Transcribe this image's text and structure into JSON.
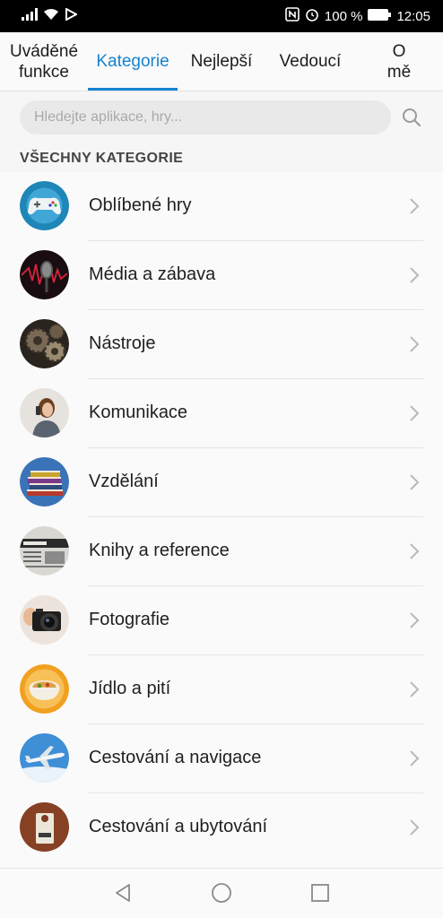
{
  "status_bar": {
    "battery_percent": "100 %",
    "time": "12:05"
  },
  "tabs": [
    {
      "label": "Uváděné\nfunkce",
      "active": false
    },
    {
      "label": "Kategorie",
      "active": true
    },
    {
      "label": "Nejlepší",
      "active": false
    },
    {
      "label": "Vedoucí",
      "active": false
    },
    {
      "label": "O\nmě",
      "active": false
    }
  ],
  "search": {
    "placeholder": "Hledejte aplikace, hry...",
    "value": ""
  },
  "section_title": "VŠECHNY KATEGORIE",
  "categories": [
    {
      "label": "Oblíbené hry",
      "icon": "gamepad-icon"
    },
    {
      "label": "Média a zábava",
      "icon": "microphone-icon"
    },
    {
      "label": "Nástroje",
      "icon": "gears-icon"
    },
    {
      "label": "Komunikace",
      "icon": "person-phone-icon"
    },
    {
      "label": "Vzdělání",
      "icon": "books-icon"
    },
    {
      "label": "Knihy a reference",
      "icon": "newspaper-icon"
    },
    {
      "label": "Fotografie",
      "icon": "camera-icon"
    },
    {
      "label": "Jídlo a pití",
      "icon": "food-bowl-icon"
    },
    {
      "label": "Cestování a navigace",
      "icon": "airplane-icon"
    },
    {
      "label": "Cestování a ubytování",
      "icon": "door-hanger-icon"
    }
  ],
  "colors": {
    "accent": "#1583d0"
  }
}
